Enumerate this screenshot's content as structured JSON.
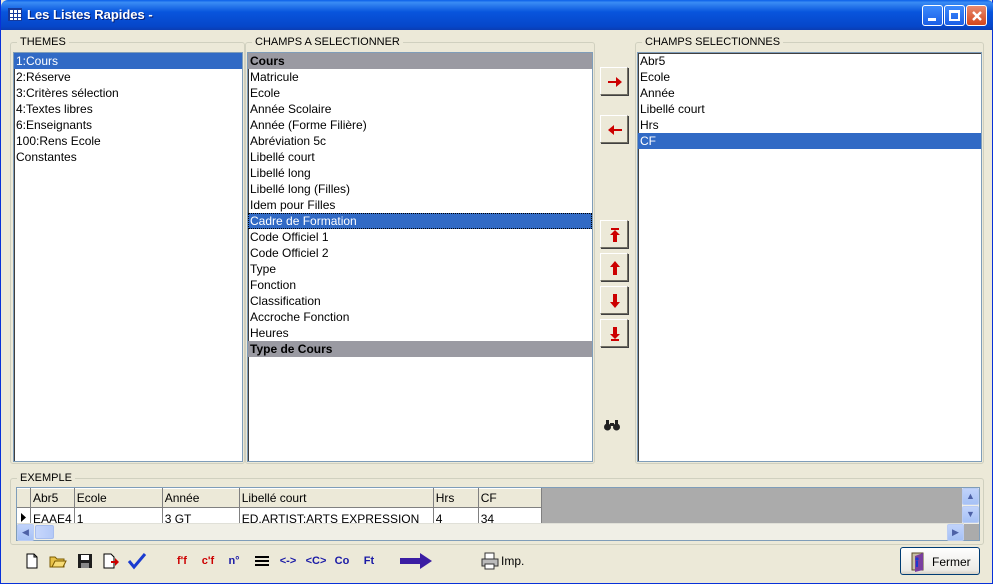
{
  "window": {
    "title": "Les Listes Rapides -"
  },
  "themes": {
    "legend": "THEMES",
    "items": [
      {
        "label": "1:Cours",
        "selected": true
      },
      {
        "label": "2:Réserve"
      },
      {
        "label": "3:Critères sélection"
      },
      {
        "label": "4:Textes libres"
      },
      {
        "label": "6:Enseignants"
      },
      {
        "label": "100:Rens Ecole"
      },
      {
        "label": "Constantes"
      }
    ]
  },
  "fields": {
    "legend": "CHAMPS A SELECTIONNER",
    "items": [
      {
        "label": "Cours",
        "kind": "header"
      },
      {
        "label": "Matricule"
      },
      {
        "label": "Ecole"
      },
      {
        "label": "Année Scolaire"
      },
      {
        "label": "Année (Forme Filière)"
      },
      {
        "label": "Abréviation 5c"
      },
      {
        "label": "Libellé court"
      },
      {
        "label": "Libellé long"
      },
      {
        "label": "Libellé long (Filles)"
      },
      {
        "label": "Idem pour Filles"
      },
      {
        "label": "Cadre de Formation",
        "kind": "selected"
      },
      {
        "label": "Code Officiel 1"
      },
      {
        "label": "Code Officiel 2"
      },
      {
        "label": "Type"
      },
      {
        "label": "Fonction"
      },
      {
        "label": "Classification"
      },
      {
        "label": "Accroche Fonction"
      },
      {
        "label": "Heures"
      },
      {
        "label": "Type de Cours",
        "kind": "header"
      }
    ]
  },
  "selected_fields": {
    "legend": "CHAMPS SELECTIONNES",
    "items": [
      {
        "label": "Abr5"
      },
      {
        "label": "Ecole"
      },
      {
        "label": "Année"
      },
      {
        "label": "Libellé court"
      },
      {
        "label": "Hrs"
      },
      {
        "label": "CF",
        "selected": true
      }
    ]
  },
  "example": {
    "legend": "EXEMPLE",
    "columns": [
      "Abr5",
      "Ecole",
      "Année",
      "Libellé court",
      "Hrs",
      "CF"
    ],
    "row": [
      "EAAE4",
      "1",
      "3 GT",
      "ED.ARTIST:ARTS EXPRESSION",
      "4",
      "34"
    ]
  },
  "toolbar": {
    "ff_label": "f'f",
    "cf_label": "c'f",
    "no_label": "n°",
    "ne_label": "<->",
    "cc_label": "<C>",
    "co_label": "Co",
    "ft_label": "Ft",
    "print_label": "Imp.",
    "close_label": "Fermer"
  },
  "colors": {
    "accent_red": "#cc0000",
    "selection": "#316ac5",
    "header_gray": "#9a9aa2",
    "arrow_purple": "#3b1da3"
  }
}
